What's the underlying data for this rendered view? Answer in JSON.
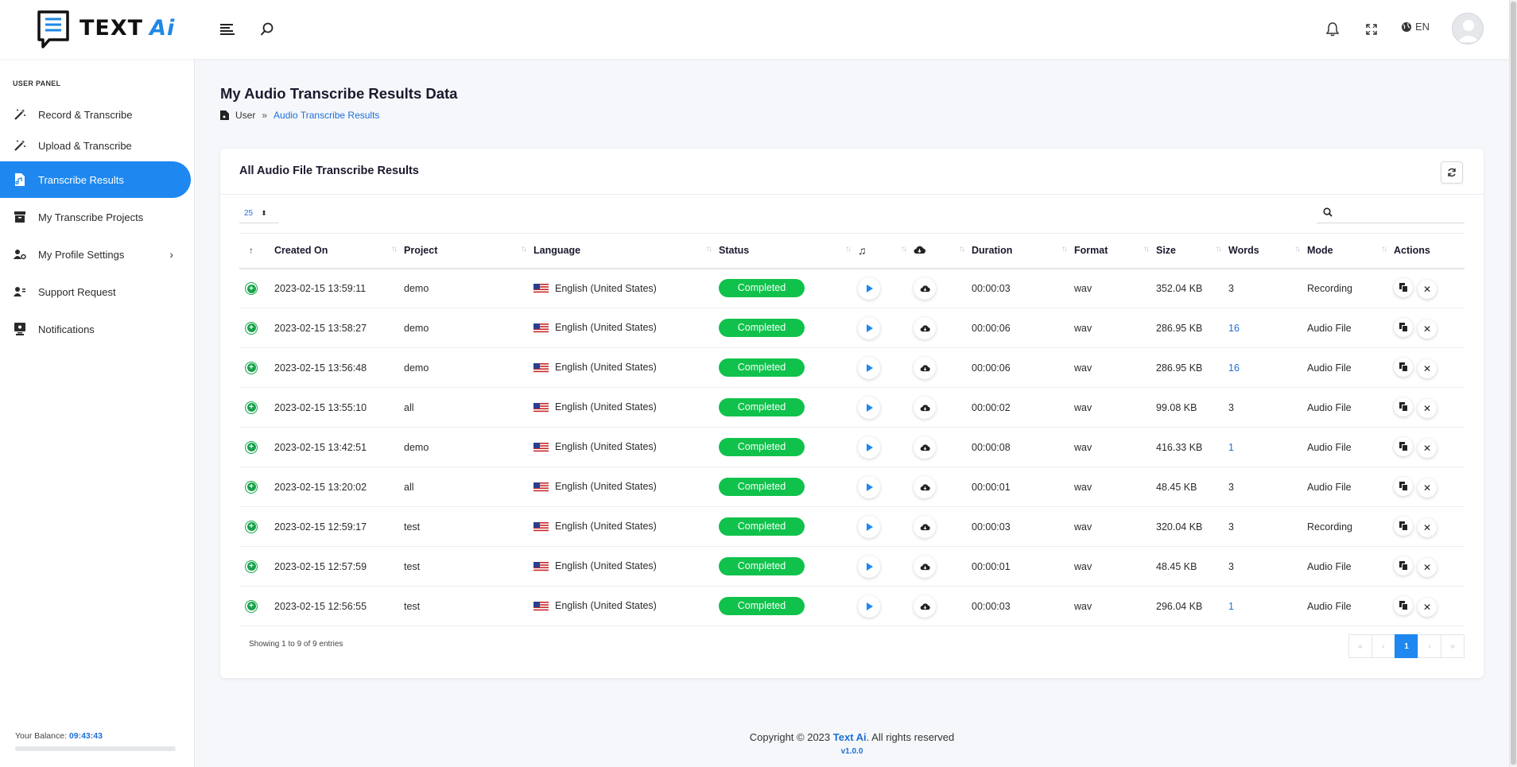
{
  "brand": {
    "name": "TEXT",
    "name_accent": "Ai",
    "accent_color": "#1e88e5"
  },
  "header": {
    "language": "EN"
  },
  "sidebar": {
    "panel_label": "USER PANEL",
    "items": [
      {
        "label": "Record & Transcribe",
        "icon": "magic-wand-icon"
      },
      {
        "label": "Upload & Transcribe",
        "icon": "magic-wand-icon"
      },
      {
        "label": "Transcribe Results",
        "icon": "file-audio-icon",
        "active": true
      },
      {
        "label": "My Transcribe Projects",
        "icon": "archive-icon"
      },
      {
        "label": "My Profile Settings",
        "icon": "user-gear-icon"
      },
      {
        "label": "Support Request",
        "icon": "user-headset-icon"
      },
      {
        "label": "Notifications",
        "icon": "monitor-bell-icon"
      }
    ],
    "balance_label": "Your Balance:",
    "balance_value": "09:43:43"
  },
  "page": {
    "title": "My Audio Transcribe Results Data",
    "breadcrumb": {
      "root": "User",
      "current": "Audio Transcribe Results"
    }
  },
  "card": {
    "title": "All Audio File Transcribe Results",
    "page_length": "25",
    "columns": [
      "Created On",
      "Project",
      "Language",
      "Status",
      "",
      "",
      "Duration",
      "Format",
      "Size",
      "Words",
      "Mode",
      "Actions"
    ],
    "rows": [
      {
        "created": "2023-02-15 13:59:11",
        "project": "demo",
        "language": "English (United States)",
        "status": "Completed",
        "duration": "00:00:03",
        "format": "wav",
        "size": "352.04 KB",
        "words": "3",
        "mode": "Recording"
      },
      {
        "created": "2023-02-15 13:58:27",
        "project": "demo",
        "language": "English (United States)",
        "status": "Completed",
        "duration": "00:00:06",
        "format": "wav",
        "size": "286.95 KB",
        "words": "16",
        "mode": "Audio File"
      },
      {
        "created": "2023-02-15 13:56:48",
        "project": "demo",
        "language": "English (United States)",
        "status": "Completed",
        "duration": "00:00:06",
        "format": "wav",
        "size": "286.95 KB",
        "words": "16",
        "mode": "Audio File"
      },
      {
        "created": "2023-02-15 13:55:10",
        "project": "all",
        "language": "English (United States)",
        "status": "Completed",
        "duration": "00:00:02",
        "format": "wav",
        "size": "99.08 KB",
        "words": "3",
        "mode": "Audio File"
      },
      {
        "created": "2023-02-15 13:42:51",
        "project": "demo",
        "language": "English (United States)",
        "status": "Completed",
        "duration": "00:00:08",
        "format": "wav",
        "size": "416.33 KB",
        "words": "1",
        "mode": "Audio File"
      },
      {
        "created": "2023-02-15 13:20:02",
        "project": "all",
        "language": "English (United States)",
        "status": "Completed",
        "duration": "00:00:01",
        "format": "wav",
        "size": "48.45 KB",
        "words": "3",
        "mode": "Audio File"
      },
      {
        "created": "2023-02-15 12:59:17",
        "project": "test",
        "language": "English (United States)",
        "status": "Completed",
        "duration": "00:00:03",
        "format": "wav",
        "size": "320.04 KB",
        "words": "3",
        "mode": "Recording"
      },
      {
        "created": "2023-02-15 12:57:59",
        "project": "test",
        "language": "English (United States)",
        "status": "Completed",
        "duration": "00:00:01",
        "format": "wav",
        "size": "48.45 KB",
        "words": "3",
        "mode": "Audio File"
      },
      {
        "created": "2023-02-15 12:56:55",
        "project": "test",
        "language": "English (United States)",
        "status": "Completed",
        "duration": "00:00:03",
        "format": "wav",
        "size": "296.04 KB",
        "words": "1",
        "mode": "Audio File"
      }
    ],
    "entries_text": "Showing 1 to 9 of 9 entries",
    "pagination": {
      "first": "«",
      "prev": "‹",
      "current": "1",
      "next": "›",
      "last": "»"
    }
  },
  "footer": {
    "copyright_prefix": "Copyright © 2023 ",
    "brand": "Text Ai",
    "copyright_suffix": ". All rights reserved",
    "version": "v1.0.0"
  },
  "colors": {
    "primary": "#1e88f0",
    "status_completed": "#10c24b",
    "link": "#1e6fd9"
  }
}
